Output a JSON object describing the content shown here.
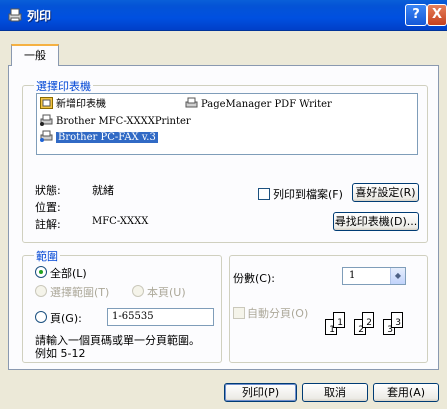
{
  "window": {
    "title": "列印",
    "help": "?",
    "close": "X"
  },
  "tabs": [
    {
      "label": "一般"
    }
  ],
  "select_printer": {
    "group_title": "選擇印表機",
    "printers": [
      {
        "name": "新增印表機",
        "icon": "add-printer-icon"
      },
      {
        "name": "PageManager PDF Writer",
        "icon": "printer-icon"
      },
      {
        "name": "Brother MFC-XXXXPrinter",
        "icon": "printer-icon"
      },
      {
        "name": "Brother PC-FAX v.3",
        "icon": "fax-printer-icon",
        "selected": true
      }
    ],
    "status_label": "狀態:",
    "status_value": "就緒",
    "location_label": "位置:",
    "location_value": "",
    "comment_label": "註解:",
    "comment_value": "MFC-XXXX",
    "print_to_file": "列印到檔案(F)",
    "preferences_button": "喜好設定(R)",
    "find_printer_button": "尋找印表機(D)..."
  },
  "page_range": {
    "group_title": "範圍",
    "all": "全部(L)",
    "selection": "選擇範圍(T)",
    "current_page": "本頁(U)",
    "pages": "頁(G):",
    "pages_value": "1-65535",
    "hint_line1": "請輸入一個頁碼或單一分頁範圍。",
    "hint_line2": "例如 5-12"
  },
  "copies": {
    "label": "份數(C):",
    "value": "1",
    "collate": "自動分頁(O)",
    "collate_pages": [
      "1",
      "1",
      "2",
      "2",
      "3",
      "3"
    ]
  },
  "buttons": {
    "print": "列印(P)",
    "cancel": "取消",
    "apply": "套用(A)"
  }
}
